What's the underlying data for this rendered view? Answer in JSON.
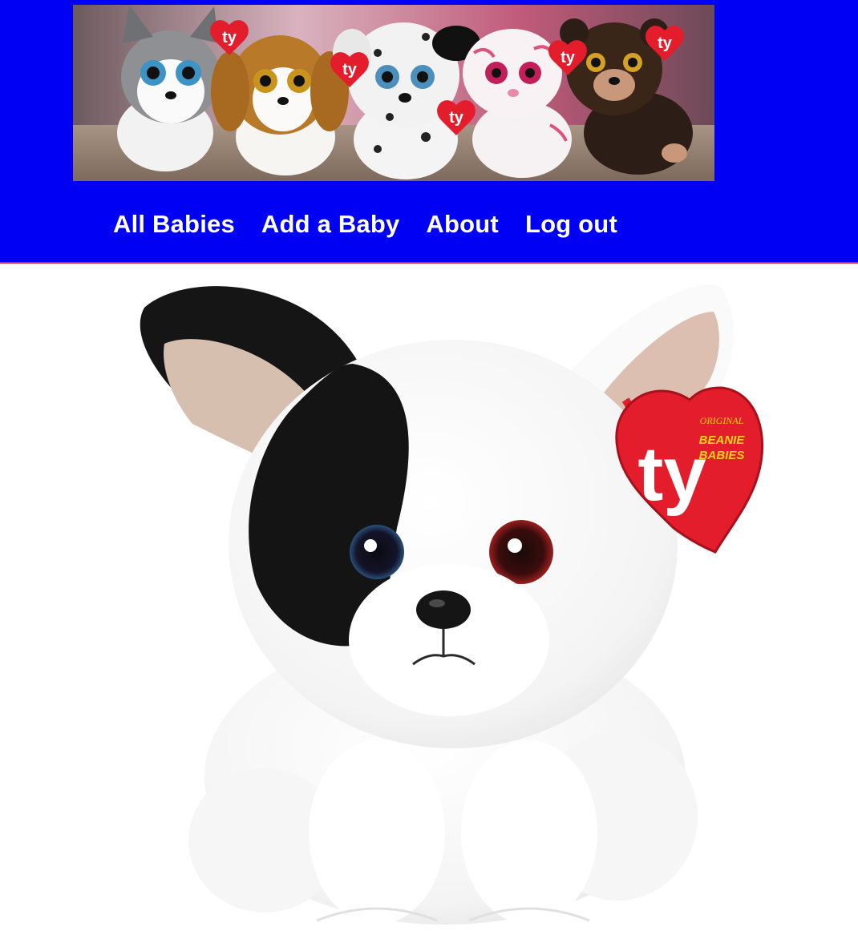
{
  "nav": {
    "items": [
      {
        "label": "All Babies"
      },
      {
        "label": "Add a Baby"
      },
      {
        "label": "About"
      },
      {
        "label": "Log out"
      }
    ]
  },
  "banner": {
    "plush_figures": [
      "husky",
      "brown-white-dog",
      "dalmatian",
      "white-tiger",
      "black-bear"
    ],
    "tag_logo_text": "ty"
  },
  "main_image": {
    "subject": "white-black-patch-dog-plush",
    "tag": {
      "logo_text": "ty",
      "line1": "ORIGINAL",
      "line2": "BEANIE",
      "line3": "BABIES"
    }
  },
  "colors": {
    "header_background": "#0000f5",
    "header_border": "#e0243a",
    "nav_text": "#ffffff",
    "tag_red": "#e31d2b",
    "tag_yellow": "#ffd21a"
  }
}
